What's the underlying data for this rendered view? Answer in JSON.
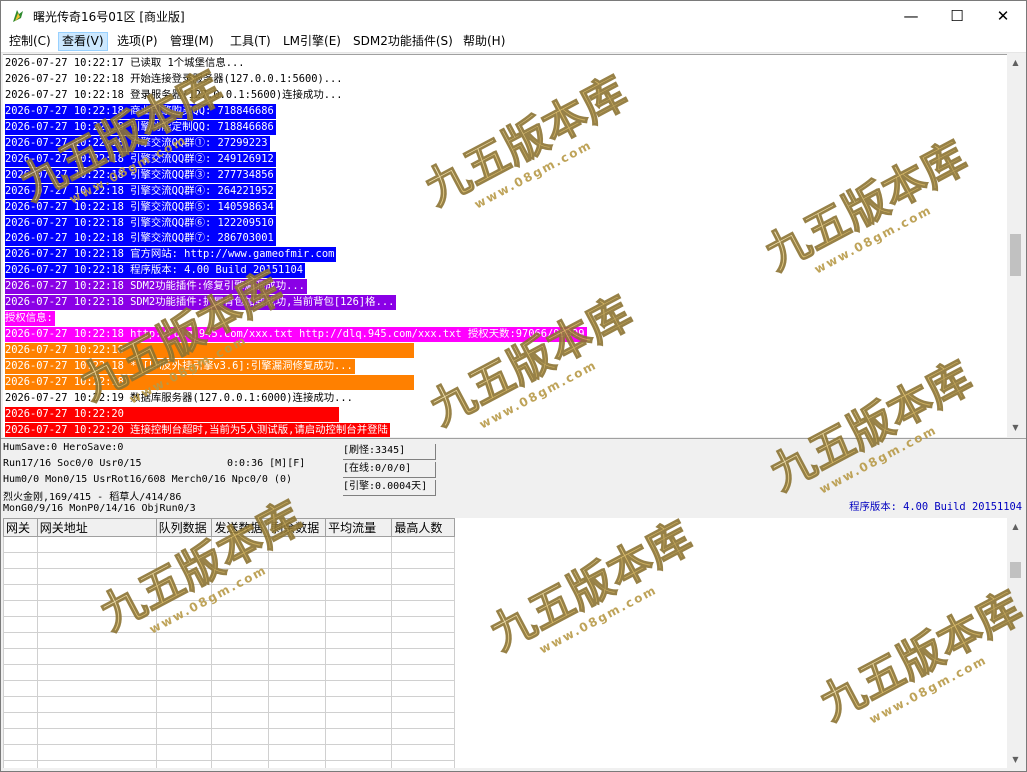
{
  "window": {
    "title": "曙光传奇16号01区 [商业版]",
    "minimize": "—",
    "maximize": "☐",
    "close": "✕"
  },
  "menu": [
    {
      "label": "控制(C)"
    },
    {
      "label": "查看(V)"
    },
    {
      "label": "选项(P)"
    },
    {
      "label": "管理(M)"
    },
    {
      "label": "工具(T)"
    },
    {
      "label": "LM引擎(E)"
    },
    {
      "label": "SDM2功能插件(S)"
    },
    {
      "label": "帮助(H)"
    }
  ],
  "log": [
    {
      "text": "2026-07-27 10:22:17 已读取 1个城堡信息...",
      "bg": "#ffffff",
      "fg": "#000000"
    },
    {
      "text": "2026-07-27 10:22:18 开始连接登录服务器(127.0.0.1:5600)...",
      "bg": "#ffffff",
      "fg": "#000000"
    },
    {
      "text": "2026-07-27 10:22:18 登录服务器(127.0.0.1:5600)连接成功...",
      "bg": "#ffffff",
      "fg": "#000000"
    },
    {
      "text": "2026-07-27 10:22:18 商业引擎购买QQ: 718846686",
      "bg": "#0000ff",
      "fg": "#ffffff"
    },
    {
      "text": "2026-07-27 10:22:18 引擎功能定制QQ: 718846686",
      "bg": "#0000ff",
      "fg": "#ffffff"
    },
    {
      "text": "2026-07-27 10:22:18 引擎交流QQ群①: 27299223",
      "bg": "#0000ff",
      "fg": "#ffffff"
    },
    {
      "text": "2026-07-27 10:22:18 引擎交流QQ群②: 249126912",
      "bg": "#0000ff",
      "fg": "#ffffff"
    },
    {
      "text": "2026-07-27 10:22:18 引擎交流QQ群③: 277734856",
      "bg": "#0000ff",
      "fg": "#ffffff"
    },
    {
      "text": "2026-07-27 10:22:18 引擎交流QQ群④: 264221952",
      "bg": "#0000ff",
      "fg": "#ffffff"
    },
    {
      "text": "2026-07-27 10:22:18 引擎交流QQ群⑤: 140598634",
      "bg": "#0000ff",
      "fg": "#ffffff"
    },
    {
      "text": "2026-07-27 10:22:18 引擎交流QQ群⑥: 122209510",
      "bg": "#0000ff",
      "fg": "#ffffff"
    },
    {
      "text": "2026-07-27 10:22:18 引擎交流QQ群⑦: 286703001",
      "bg": "#0000ff",
      "fg": "#ffffff"
    },
    {
      "text": "2026-07-27 10:22:18 官方网站: http://www.gameofmir.com",
      "bg": "#0000ff",
      "fg": "#ffffff"
    },
    {
      "text": "2026-07-27 10:22:18 程序版本: 4.00 Build 20151104",
      "bg": "#0000ff",
      "fg": "#ffffff"
    },
    {
      "text": "2026-07-27 10:22:18 SDM2功能插件:修复引擎漏洞成功...",
      "bg": "#8a00e6",
      "fg": "#ffffff"
    },
    {
      "text": "2026-07-27 10:22:18 SDM2功能插件:扩展背包加载成功,当前背包[126]格...",
      "bg": "#8a00e6",
      "fg": "#ffffff"
    },
    {
      "text": "授权信息:",
      "bg": "#ff00ff",
      "fg": "#ffffff"
    },
    {
      "text": "2026-07-27 10:22:18 http://dlq.945.com/xxx.txt http://dlq.945.com/xxx.txt 授权天数:97066/99999",
      "bg": "#ff00ff",
      "fg": "#ffffff"
    },
    {
      "text": "2026-07-27 10:22:18                                              ",
      "bg": "#ff8000",
      "fg": "#ffffff"
    },
    {
      "text": "2026-07-27 10:22:18 * [LM反外挂引擎v3.6]:引擎漏洞修复成功...",
      "bg": "#ff8000",
      "fg": "#ffffff"
    },
    {
      "text": "2026-07-27 10:22:18                                              ",
      "bg": "#ff8000",
      "fg": "#ffffff"
    },
    {
      "text": "2026-07-27 10:22:19 数据库服务器(127.0.0.1:6000)连接成功...",
      "bg": "#ffffff",
      "fg": "#000000"
    },
    {
      "text": "2026-07-27 10:22:20                                  ",
      "bg": "#ff0000",
      "fg": "#ffffff"
    },
    {
      "text": "2026-07-27 10:22:20 连接控制台超时,当前为5人测试版,请启动控制台并登陆",
      "bg": "#ff0000",
      "fg": "#ffffff"
    }
  ],
  "status": {
    "line1": "HumSave:0 HeroSave:0",
    "line2": "Run17/16 Soc0/0 Usr0/15",
    "timer": "0:0:36 [M][F]",
    "line3": "Hum0/0 Mon0/15 UsrRot16/608 Merch0/16 Npc0/0 (0)",
    "line4": "烈火金刚,169/415 - 稻草人/414/86",
    "line5": "MonG0/9/16 MonP0/14/16 ObjRun0/3",
    "box1": "[刷怪:3345]",
    "box2": "[在线:0/0/0]",
    "box3": "[引擎:0.0004天]",
    "build": "程序版本: 4.00 Build 20151104"
  },
  "gateway_table": {
    "columns": [
      "网关",
      "网关地址",
      "队列数据",
      "发送数据",
      "剩余数据",
      "平均流量",
      "最高人数"
    ]
  },
  "watermark": {
    "main": "九五版本库",
    "sub": "www.08gm.com"
  },
  "colors": {
    "log_blue": "#0000ff",
    "log_purple": "#8a00e6",
    "log_magenta": "#ff00ff",
    "log_orange": "#ff8000",
    "log_red": "#ff0000",
    "build_text": "#0000c0"
  }
}
